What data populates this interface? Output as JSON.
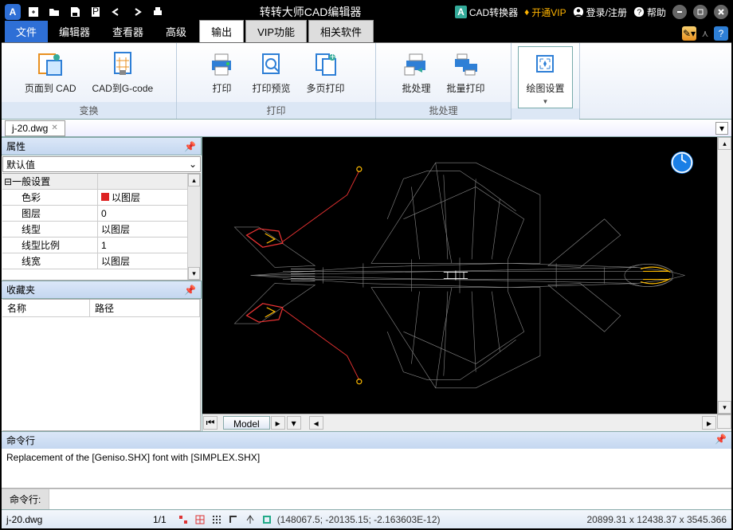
{
  "title": "转转大师CAD编辑器",
  "titlebar": {
    "converter": "CAD转换器",
    "vip": "开通VIP",
    "login": "登录/注册",
    "help": "帮助"
  },
  "menu": {
    "file": "文件",
    "editor": "编辑器",
    "viewer": "查看器",
    "advanced": "高级",
    "output": "输出",
    "vip": "VIP功能",
    "related": "相关软件"
  },
  "ribbon": {
    "groups": {
      "convert": "变换",
      "print": "打印",
      "batch": "批处理"
    },
    "btns": {
      "pageToCad": "页面到 CAD",
      "cadToGcode": "CAD到G-code",
      "print": "打印",
      "printPreview": "打印预览",
      "multiPrint": "多页打印",
      "batch": "批处理",
      "batchPrint": "批量打印",
      "plotSettings": "绘图设置"
    }
  },
  "docTab": "j-20.dwg",
  "panels": {
    "props": "属性",
    "default": "默认值",
    "general": "一般设置",
    "rows": {
      "color": {
        "label": "色彩",
        "value": "以图层"
      },
      "layer": {
        "label": "图层",
        "value": "0"
      },
      "linetype": {
        "label": "线型",
        "value": "以图层"
      },
      "ltscale": {
        "label": "线型比例",
        "value": "1"
      },
      "lweight": {
        "label": "线宽",
        "value": "以图层"
      }
    },
    "favorites": "收藏夹",
    "favCols": {
      "name": "名称",
      "path": "路径"
    }
  },
  "modelTab": "Model",
  "cmd": {
    "title": "命令行",
    "output": "Replacement of the [Geniso.SHX] font with [SIMPLEX.SHX]",
    "label": "命令行:"
  },
  "status": {
    "file": "j-20.dwg",
    "page": "1/1",
    "coord": "(148067.5; -20135.15; -2.163603E-12)",
    "dims": "20899.31 x 12438.37 x 3545.366"
  }
}
